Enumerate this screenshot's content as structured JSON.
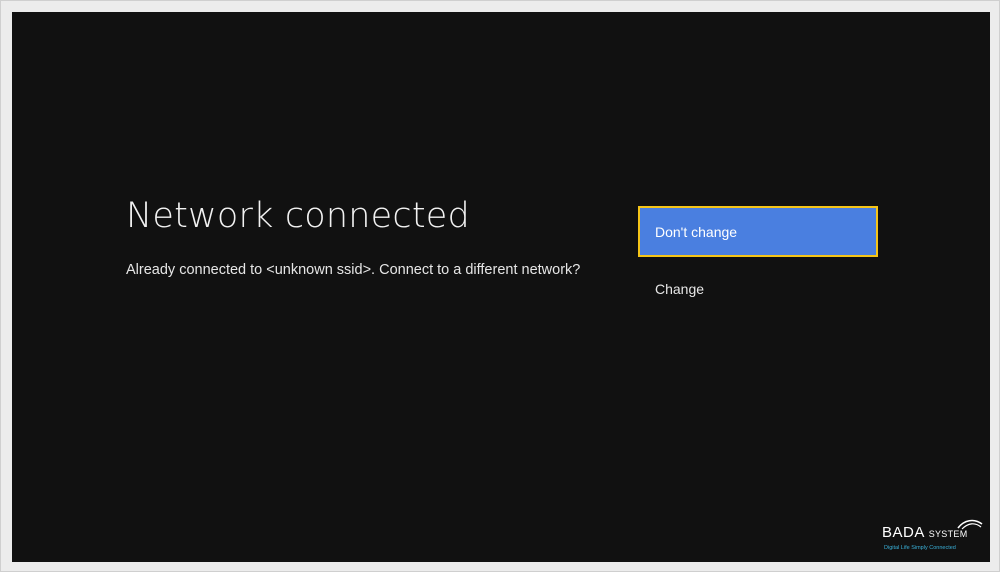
{
  "dialog": {
    "title": "Network connected",
    "message": "Already connected to <unknown ssid>. Connect to a different network?"
  },
  "options": [
    {
      "label": "Don't change",
      "focused": true
    },
    {
      "label": "Change",
      "focused": false
    }
  ],
  "watermark": {
    "brand": "BADA",
    "brand_sub": "SYSTEM",
    "tagline": "Digital Life Simply Connected"
  },
  "colors": {
    "background": "#111111",
    "focus_fill": "#4a7fe0",
    "focus_border": "#f5c518",
    "tagline": "#3ab0d8"
  }
}
